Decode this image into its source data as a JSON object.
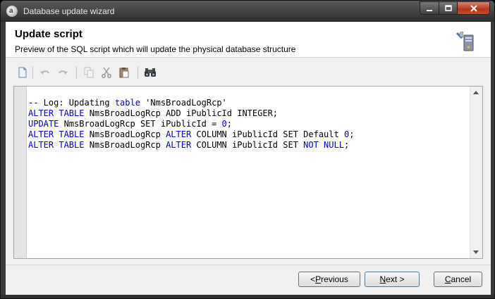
{
  "window": {
    "title": "Database update wizard"
  },
  "header": {
    "title": "Update script",
    "subtitle": "Preview of the SQL script which will update the physical database structure"
  },
  "toolbar": {
    "items": [
      "new-document-icon",
      "undo-icon",
      "redo-icon",
      "copy-icon",
      "cut-icon",
      "paste-icon",
      "find-icon"
    ]
  },
  "script": {
    "lines": [
      [
        {
          "t": "-- Log: Updating ",
          "k": false
        },
        {
          "t": "table",
          "k": true
        },
        {
          "t": " 'NmsBroadLogRcp'",
          "k": false
        }
      ],
      [
        {
          "t": "ALTER TABLE",
          "k": true
        },
        {
          "t": " NmsBroadLogRcp ADD iPublicId INTEGER;",
          "k": false
        }
      ],
      [
        {
          "t": "UPDATE",
          "k": true
        },
        {
          "t": " NmsBroadLogRcp SET iPublicId = ",
          "k": false
        },
        {
          "t": "0",
          "k": true
        },
        {
          "t": ";",
          "k": false
        }
      ],
      [
        {
          "t": "ALTER TABLE",
          "k": true
        },
        {
          "t": " NmsBroadLogRcp ",
          "k": false
        },
        {
          "t": "ALTER",
          "k": true
        },
        {
          "t": " COLUMN iPublicId SET Default ",
          "k": false
        },
        {
          "t": "0",
          "k": true
        },
        {
          "t": ";",
          "k": false
        }
      ],
      [
        {
          "t": "ALTER TABLE",
          "k": true
        },
        {
          "t": " NmsBroadLogRcp ",
          "k": false
        },
        {
          "t": "ALTER",
          "k": true
        },
        {
          "t": " COLUMN iPublicId SET ",
          "k": false
        },
        {
          "t": "NOT NULL",
          "k": true
        },
        {
          "t": ";",
          "k": false
        }
      ]
    ]
  },
  "buttons": {
    "previous_prefix": "< ",
    "previous_key": "P",
    "previous_rest": "revious",
    "next_key": "N",
    "next_rest": "ext >",
    "cancel_key": "C",
    "cancel_rest": "ancel"
  },
  "colors": {
    "keyword": "#0000c8",
    "titlebar": "#3a3a3a"
  }
}
